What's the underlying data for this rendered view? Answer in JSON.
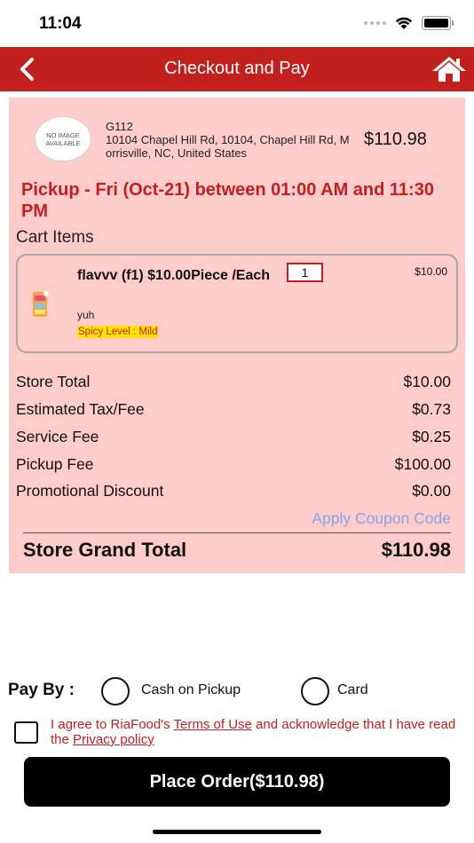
{
  "status_bar": {
    "time": "11:04"
  },
  "header": {
    "title": "Checkout and Pay",
    "back_icon": "chevron-left-icon",
    "home_icon": "home-icon"
  },
  "store": {
    "image_placeholder_line1": "NO IMAGE",
    "image_placeholder_line2": "AVAILABLE",
    "name": "G112",
    "address": "10104 Chapel Hill Rd, 10104, Chapel Hill Rd, Morrisville, NC, United States",
    "total": "$110.98"
  },
  "pickup": {
    "text": "Pickup - Fri (Oct-21) between 01:00 AM and 11:30 PM"
  },
  "cart": {
    "title": "Cart Items",
    "items": [
      {
        "name": "flavvv (f1) $10.00Piece /Each",
        "quantity": "1",
        "price": "$10.00",
        "note": "yuh",
        "spicy_level": "Spicy Level : Mild"
      }
    ]
  },
  "summary": {
    "rows": [
      {
        "label": "Store Total",
        "value": "$10.00"
      },
      {
        "label": "Estimated Tax/Fee",
        "value": "$0.73"
      },
      {
        "label": "Service Fee",
        "value": "$0.25"
      },
      {
        "label": "Pickup Fee",
        "value": "$100.00"
      },
      {
        "label": "Promotional Discount",
        "value": "$0.00"
      }
    ],
    "coupon_link": "Apply Coupon Code",
    "grand_total_label": "Store Grand Total",
    "grand_total_value": "$110.98"
  },
  "payment": {
    "label": "Pay By :",
    "options": [
      {
        "label": "Cash on Pickup",
        "selected": false
      },
      {
        "label": "Card",
        "selected": false
      }
    ]
  },
  "terms": {
    "prefix": "I agree to RiaFood's ",
    "terms_link": "Terms of Use",
    "middle": " and acknowledge that I have read the ",
    "privacy_link": "Privacy policy",
    "checked": false
  },
  "place_order": {
    "label": "Place Order($110.98)"
  },
  "colors": {
    "brand_red": "#c21f1f",
    "card_pink": "#ffcccc",
    "link_blue": "#86a8e8",
    "highlight_yellow": "#ffe400"
  }
}
